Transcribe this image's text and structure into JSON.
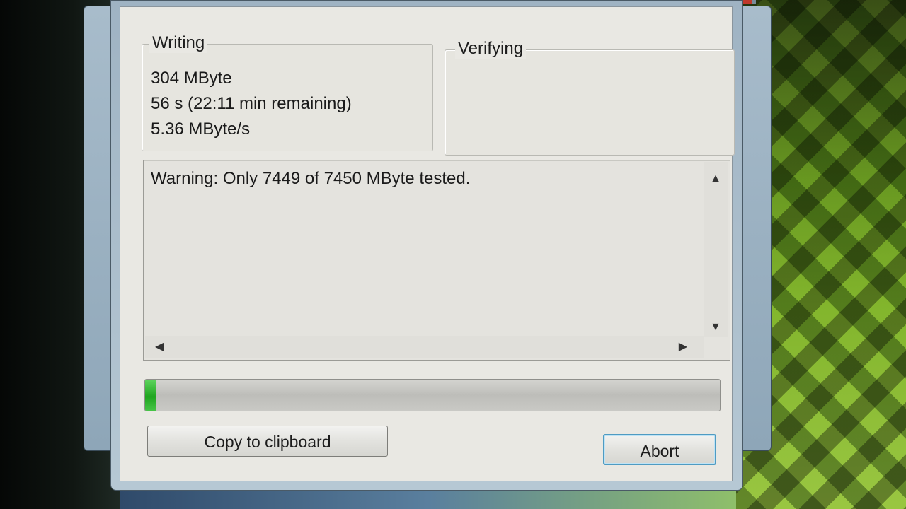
{
  "writing": {
    "title": "Writing",
    "amount": "304 MByte",
    "elapsed": "56 s (22:11 min remaining)",
    "speed": "5.36 MByte/s"
  },
  "verifying": {
    "title": "Verifying"
  },
  "log": {
    "message": "Warning: Only 7449 of 7450 MByte tested."
  },
  "progress": {
    "fraction": 0.02,
    "color": "#1fa51f"
  },
  "buttons": {
    "copy_label": "Copy to clipboard",
    "abort_label": "Abort"
  },
  "colors": {
    "accent_focus_border": "#4f9bc2"
  }
}
